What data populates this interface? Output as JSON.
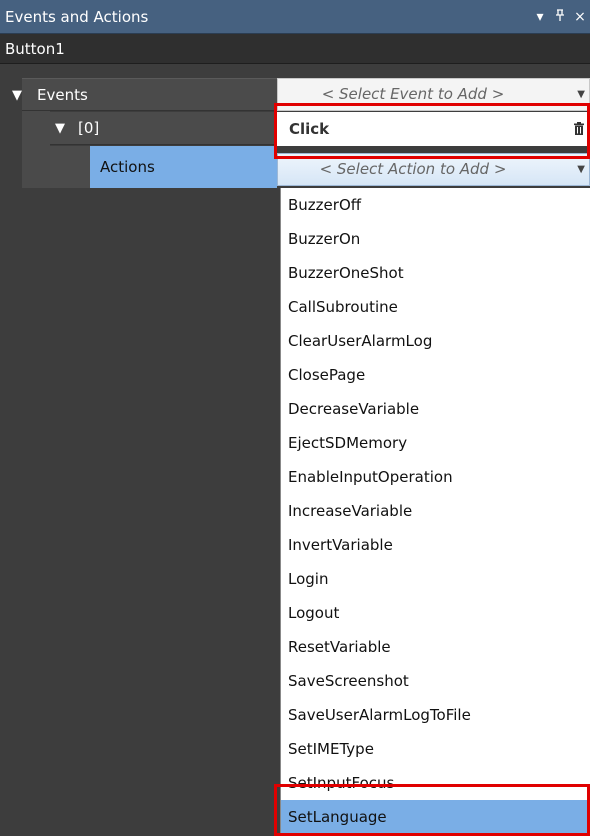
{
  "panel": {
    "title": "Events and Actions",
    "controls": {
      "dropdown_glyph": "▾",
      "pin_glyph": "ᅟ⊥",
      "close_glyph": "×"
    }
  },
  "object_name": "Button1",
  "tree": {
    "events_label": "Events",
    "index_label": "[0]",
    "actions_label": "Actions",
    "expand_glyph": "▼"
  },
  "event_selector": {
    "placeholder": "< Select Event to Add >"
  },
  "event_entry": {
    "value": "Click"
  },
  "action_selector": {
    "placeholder": "< Select Action to Add >"
  },
  "action_options": [
    "BuzzerOff",
    "BuzzerOn",
    "BuzzerOneShot",
    "CallSubroutine",
    "ClearUserAlarmLog",
    "ClosePage",
    "DecreaseVariable",
    "EjectSDMemory",
    "EnableInputOperation",
    "IncreaseVariable",
    "InvertVariable",
    "Login",
    "Logout",
    "ResetVariable",
    "SaveScreenshot",
    "SaveUserAlarmLogToFile",
    "SetIMEType",
    "SetInputFocus",
    "SetLanguage"
  ],
  "selected_action": "SetLanguage",
  "colors": {
    "title_bar": "#466180",
    "selection": "#7aaee6",
    "highlight_box": "#e00000",
    "panel_bg": "#3d3d3d"
  },
  "icons": {
    "expand": "triangle-down-icon",
    "delete": "trash-icon",
    "combo": "caret-down-icon"
  }
}
